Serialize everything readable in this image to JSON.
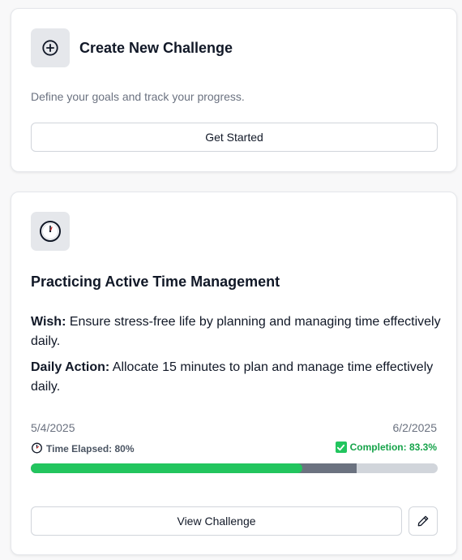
{
  "create_card": {
    "icon": "plus-circle-icon",
    "title": "Create New Challenge",
    "description": "Define your goals and track your progress.",
    "button_label": "Get Started"
  },
  "challenge_card": {
    "icon": "clock-icon",
    "title": "Practicing Active Time Management",
    "wish_label": "Wish:",
    "wish_text": "Ensure stress-free life by planning and managing time effectively daily.",
    "action_label": "Daily Action:",
    "action_text": "Allocate 15 minutes to plan and manage time effectively daily.",
    "start_date": "5/4/2025",
    "end_date": "6/2/2025",
    "time_elapsed_label": "Time Elapsed: 80%",
    "time_elapsed_pct": 80,
    "completion_label": "Completion: 83.3%",
    "completion_pct": 83.3,
    "progress_green_pct": 66.7,
    "view_button_label": "View Challenge",
    "edit_icon": "pencil-icon"
  },
  "colors": {
    "accent_green": "#22c55e",
    "elapsed_gray": "#6b7280",
    "track_gray": "#d1d5db",
    "completion_text": "#16a34a"
  }
}
